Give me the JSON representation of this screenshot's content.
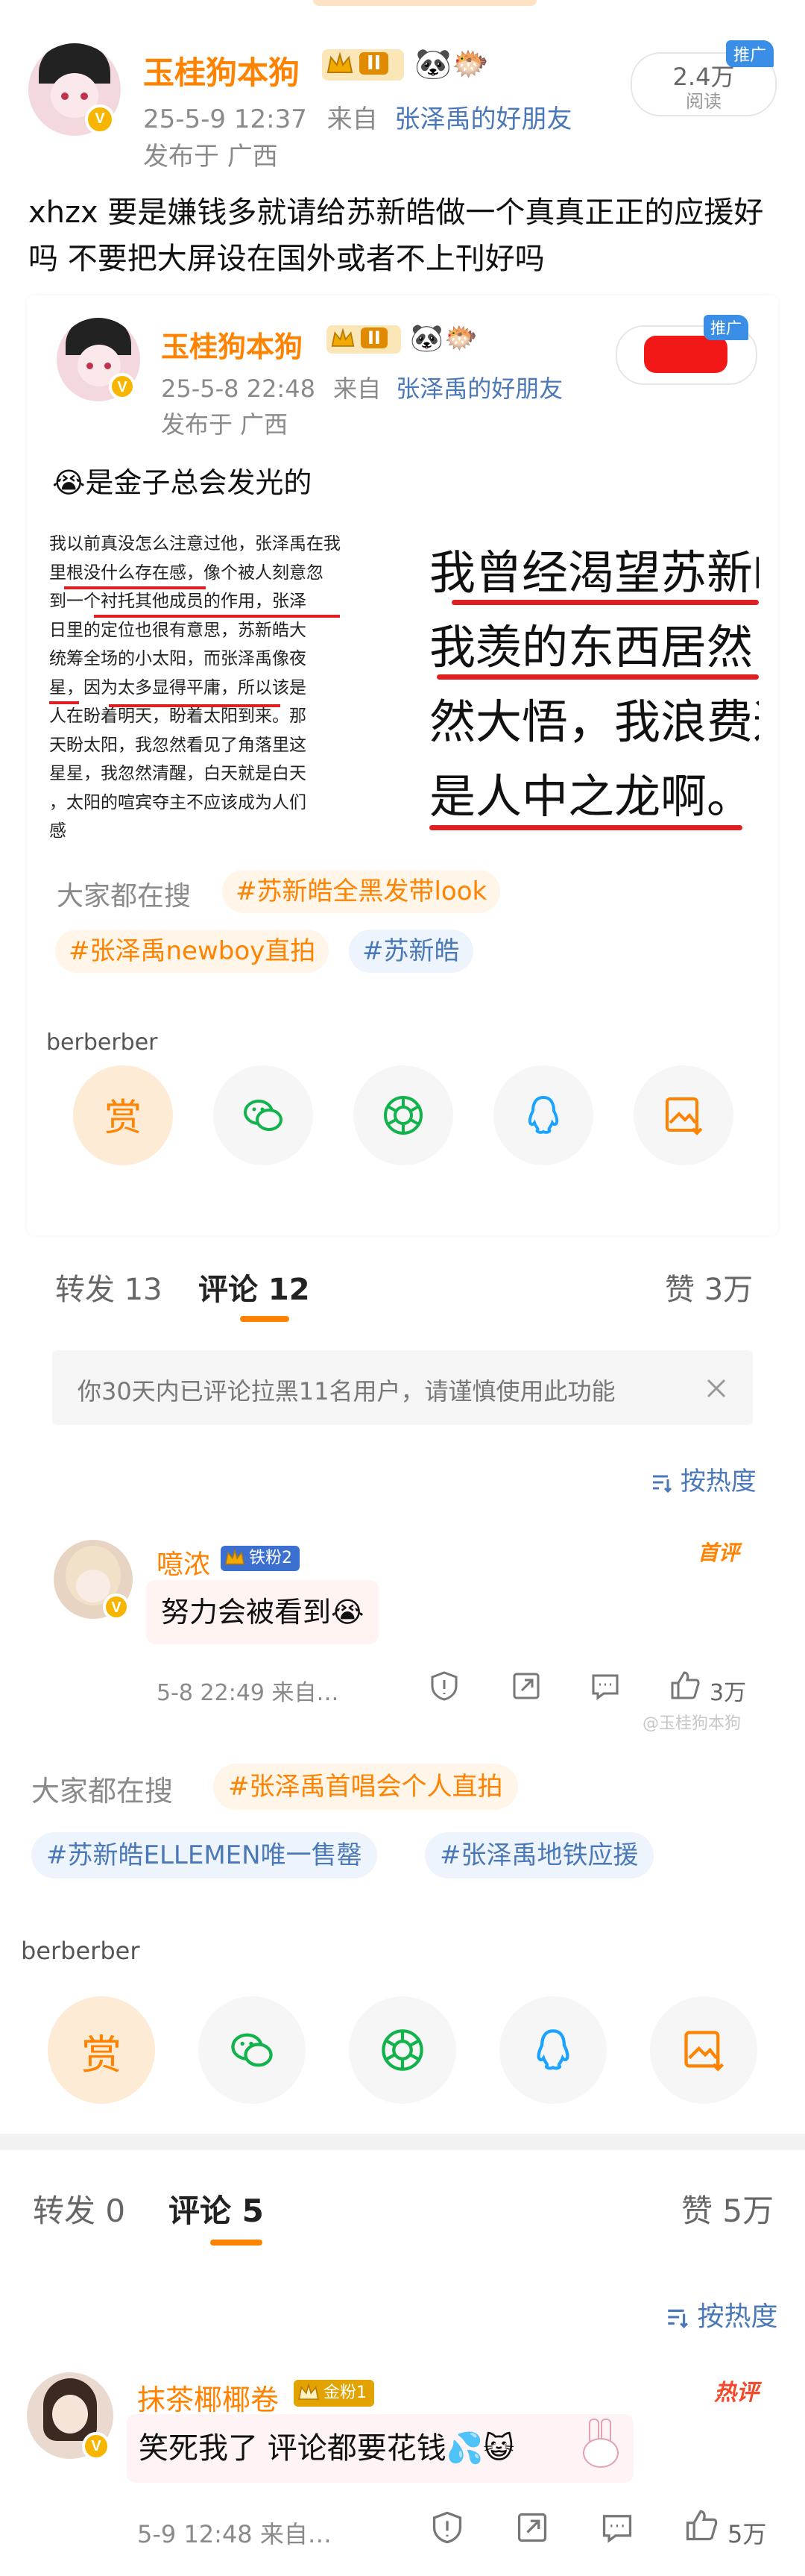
{
  "post": {
    "author": "玉桂狗本狗",
    "level": "II",
    "time": "25-5-9 12:37",
    "source_prefix": "来自",
    "source": "张泽禹的好朋友",
    "location": "发布于 广西",
    "read_count": "2.4万",
    "read_label": "阅读",
    "ad_tag": "推广",
    "text": "xhzx 要是嫌钱多就请给苏新皓做一个真真正正的应援好吗 不要把大屏设在国外或者不上刊好吗"
  },
  "repost": {
    "author": "玉桂狗本狗",
    "level": "II",
    "time": "25-5-8 22:48",
    "source_prefix": "来自",
    "source": "张泽禹的好朋友",
    "location": "发布于 广西",
    "ad_tag": "推广",
    "text": "😭是金子总会发光的",
    "image_left_lines": [
      "我以前真没怎么注意过他，张泽禹在我",
      "里根没什么存在感，像个被人刻意忽",
      "到一个衬托其他成员的作用，张泽",
      "日里的定位也很有意思，苏新皓大",
      "统筹全场的小太阳，而张泽禹像夜",
      "星，因为太多显得平庸，所以该是",
      "人在盼着明天，盼着太阳到来。那",
      "天盼太阳，我忽然看见了角落里这",
      "星星，我忽然清醒，白天就是白天",
      "，太阳的喧宾夺主不应该成为人们",
      "感"
    ],
    "image_right_lines": [
      "我曾经渴望苏新皓",
      "我羡的东西居然",
      "然大悟，我浪费这",
      "是人中之龙啊。"
    ],
    "everyone_searching": "大家都在搜",
    "topics": [
      "#苏新皓全黑发带look",
      "#张泽禹newboy直拍",
      "#苏新皓"
    ],
    "reward_user": "berberber",
    "reward_label": "赏",
    "tabs": {
      "repost": "转发 13",
      "comment": "评论 12",
      "like": "赞 3万"
    },
    "notice": "你30天内已评论拉黑11名用户，请谨慎使用此功能",
    "sort": "按热度",
    "comment": {
      "user": "噫浓",
      "fan_badge": "铁粉2",
      "tag": "首评",
      "text": "努力会被看到😭",
      "time": "5-8 22:49 来自…",
      "likes": "3万"
    },
    "watermark": "@玉桂狗本狗"
  },
  "bottom": {
    "everyone_searching": "大家都在搜",
    "topics": [
      "#张泽禹首唱会个人直拍",
      "#苏新皓ELLEMEN唯一售罄",
      "#张泽禹地铁应援"
    ],
    "reward_user": "berberber",
    "reward_label": "赏",
    "tabs": {
      "repost": "转发 0",
      "comment": "评论 5",
      "like": "赞 5万"
    },
    "sort": "按热度",
    "comment": {
      "user": "抹茶椰椰卷",
      "fan_badge": "金粉1",
      "tag": "热评",
      "text": "笑死我了 评论都要花钱💦😺",
      "time": "5-9 12:48 来自…",
      "likes": "5万"
    }
  },
  "icons": [
    "wechat-icon",
    "moments-icon",
    "qq-icon",
    "save-image-icon",
    "report-icon",
    "share-icon",
    "comment-icon",
    "like-icon",
    "close-icon",
    "sort-icon"
  ],
  "colors": {
    "brand_orange": "#ff8200",
    "link_blue": "#4b78b8",
    "ad_blue": "#3a8ee6",
    "underline_red": "#e02020"
  }
}
